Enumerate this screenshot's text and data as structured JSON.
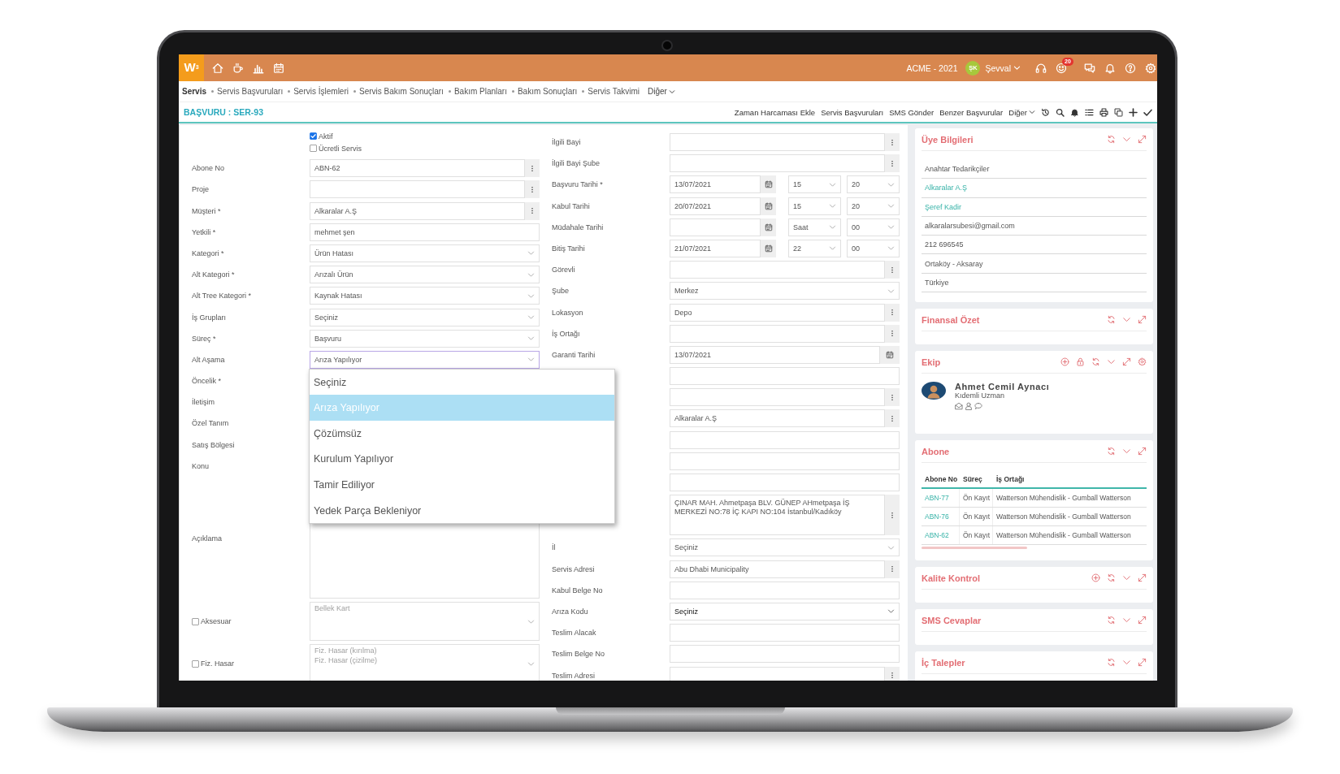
{
  "top_bar": {
    "logo": "W$^{3}$",
    "company": "ACME - 2021",
    "user": {
      "initials": "ŞK",
      "name": "Şevval"
    },
    "notification_count": "20"
  },
  "module_tabs": {
    "items": [
      {
        "label": "Servis",
        "selected": true
      },
      {
        "label": "Servis Başvuruları",
        "selected": false
      },
      {
        "label": "Servis İşlemleri",
        "selected": false
      },
      {
        "label": "Servis Bakım Sonuçları",
        "selected": false
      },
      {
        "label": "Bakım Planları",
        "selected": false
      },
      {
        "label": "Bakım Sonuçları",
        "selected": false
      },
      {
        "label": "Servis Takvimi",
        "selected": false
      }
    ],
    "more": "Diğer"
  },
  "page_header": {
    "title": "BAŞVURU : SER-93",
    "actions": [
      "Zaman Harcaması Ekle",
      "Servis Başvuruları",
      "SMS Gönder",
      "Benzer Başvurular"
    ],
    "more": "Diğer"
  },
  "form": {
    "checkboxes": [
      {
        "label": "Aktif",
        "checked": true
      },
      {
        "label": "Ücretli Servis",
        "checked": false
      }
    ],
    "left_rows": [
      {
        "label": "Abone No",
        "field": {
          "kind": "lookup",
          "value": "ABN-62"
        }
      },
      {
        "label": "Proje",
        "field": {
          "kind": "lookup"
        }
      },
      {
        "label": "Müşteri *",
        "field": {
          "kind": "lookup",
          "value": "Alkaralar A.Ş"
        }
      },
      {
        "label": "Yetkili *",
        "field": {
          "kind": "text",
          "value": "mehmet şen"
        }
      },
      {
        "label": "Kategori *",
        "field": {
          "kind": "select",
          "value": "Ürün Hatası"
        }
      },
      {
        "label": "Alt Kategori *",
        "field": {
          "kind": "select",
          "value": "Arızalı Ürün"
        }
      },
      {
        "label": "Alt Tree Kategori *",
        "field": {
          "kind": "select",
          "value": "Kaynak Hatası"
        }
      },
      {
        "label": "İş Grupları",
        "field": {
          "kind": "select",
          "value": "Seçiniz"
        }
      },
      {
        "label": "Süreç *",
        "field": {
          "kind": "select",
          "value": "Başvuru"
        }
      },
      {
        "label": "Alt Aşama",
        "field": {
          "kind": "select",
          "value": "Arıza Yapılıyor",
          "focused": true,
          "open": true,
          "options": [
            {
              "label": "Seçiniz",
              "selected": false
            },
            {
              "label": "Arıza Yapılıyor",
              "selected": true
            },
            {
              "label": "Çözümsüz",
              "selected": false
            },
            {
              "label": "Kurulum Yapılıyor",
              "selected": false
            },
            {
              "label": "Tamir Ediliyor",
              "selected": false
            },
            {
              "label": "Yedek Parça Bekleniyor",
              "selected": false
            }
          ]
        }
      },
      {
        "label": "Öncelik *"
      },
      {
        "label": "İletişim"
      },
      {
        "label": "Özel Tanım"
      },
      {
        "label": "Satış Bölgesi"
      },
      {
        "label": "Konu"
      },
      {
        "label": "Açıklama",
        "field": {
          "kind": "textarea"
        }
      },
      {
        "label": "Aksesuar",
        "checked": false,
        "field": {
          "kind": "listbox",
          "options": [
            "Bellek Kart"
          ]
        }
      },
      {
        "label": "Fiz. Hasar",
        "checked": false,
        "field": {
          "kind": "listbox",
          "options": [
            "Fiz. Hasar (kırılma)",
            "Fiz. Hasar (çizilme)"
          ]
        }
      }
    ],
    "right_rows": [
      {
        "label": "İlgili Bayi",
        "field": {
          "kind": "lookup"
        }
      },
      {
        "label": "İlgili Bayi Şube",
        "field": {
          "kind": "lookup"
        }
      },
      {
        "label": "Başvuru Tarihi *",
        "field": {
          "kind": "datetime",
          "date": "13/07/2021",
          "hour": "15",
          "minute": "20"
        }
      },
      {
        "label": "Kabul Tarihi",
        "field": {
          "kind": "datetime",
          "date": "20/07/2021",
          "hour": "15",
          "minute": "20"
        }
      },
      {
        "label": "Müdahale Tarihi",
        "field": {
          "kind": "datetime",
          "hour": "Saat",
          "minute": "00"
        }
      },
      {
        "label": "Bitiş Tarihi",
        "field": {
          "kind": "datetime",
          "date": "21/07/2021",
          "hour": "22",
          "minute": "00"
        }
      },
      {
        "label": "Görevli",
        "field": {
          "kind": "lookup"
        }
      },
      {
        "label": "Şube",
        "field": {
          "kind": "select",
          "value": "Merkez"
        }
      },
      {
        "label": "Lokasyon",
        "field": {
          "kind": "lookup",
          "value": "Depo"
        }
      },
      {
        "label": "İş Ortağı",
        "field": {
          "kind": "lookup"
        }
      },
      {
        "label": "Garanti Tarihi",
        "field": {
          "kind": "date",
          "value": "13/07/2021"
        }
      },
      {
        "field": {
          "kind": "text"
        }
      },
      {
        "field": {
          "kind": "lookup"
        }
      },
      {
        "field": {
          "kind": "lookup",
          "value": "Alkaralar A.Ş"
        }
      },
      {
        "field": {
          "kind": "text"
        }
      },
      {
        "field": {
          "kind": "text"
        }
      },
      {
        "field": {
          "kind": "text"
        }
      },
      {
        "field": {
          "kind": "address",
          "value": "ÇINAR MAH. Ahmetpaşa BLV. GÜNEP AHmetpaşa İŞ MERKEZİ NO:78 İÇ KAPI NO:104 İstanbul/Kadıköy"
        }
      },
      {
        "label": "İl",
        "field": {
          "kind": "select",
          "value": "Seçiniz"
        }
      },
      {
        "label": "Servis Adresi",
        "field": {
          "kind": "lookup",
          "value": "Abu Dhabi Municipality"
        }
      },
      {
        "label": "Kabul Belge No",
        "field": {
          "kind": "text"
        }
      },
      {
        "label": "Arıza Kodu",
        "field": {
          "kind": "native_select",
          "value": "Seçiniz"
        }
      },
      {
        "label": "Teslim Alacak",
        "field": {
          "kind": "text"
        }
      },
      {
        "label": "Teslim Belge No",
        "field": {
          "kind": "text"
        }
      },
      {
        "label": "Teslim Adresi",
        "field": {
          "kind": "lookup"
        }
      }
    ]
  },
  "side_panels": [
    {
      "title": "Üye Bilgileri",
      "kind": "list",
      "add_button": false,
      "lock_button": false,
      "settings_button": false,
      "items": [
        {
          "text": "Anahtar Tedarikçiler",
          "link": false
        },
        {
          "text": "Alkaralar A.Ş",
          "link": true
        },
        {
          "text": "Şeref Kadir",
          "link": true
        },
        {
          "text": "alkaralarsubesi@gmail.com",
          "link": false
        },
        {
          "text": "212 696545",
          "link": false
        },
        {
          "text": "Ortaköy - Aksaray",
          "link": false
        },
        {
          "text": "Türkiye",
          "link": false
        }
      ]
    },
    {
      "title": "Finansal Özet",
      "kind": "empty",
      "add_button": false,
      "lock_button": false,
      "settings_button": false
    },
    {
      "title": "Ekip",
      "kind": "team",
      "add_button": true,
      "lock_button": true,
      "settings_button": true,
      "members": [
        {
          "name": "Ahmet Cemil Aynacı",
          "role": "Kıdemli Uzman"
        }
      ]
    },
    {
      "title": "Abone",
      "kind": "table",
      "add_button": false,
      "lock_button": false,
      "settings_button": false,
      "columns": [
        "Abone No",
        "Süreç",
        "İş Ortağı"
      ],
      "rows": [
        [
          "ABN-77",
          "Ön Kayıt",
          "Watterson Mühendislik - Gumball Watterson"
        ],
        [
          "ABN-76",
          "Ön Kayıt",
          "Watterson Mühendislik - Gumball Watterson"
        ],
        [
          "ABN-62",
          "Ön Kayıt",
          "Watterson Mühendislik - Gumball Watterson"
        ]
      ]
    },
    {
      "title": "Kalite Kontrol",
      "kind": "empty",
      "add_button": true,
      "lock_button": false,
      "settings_button": false
    },
    {
      "title": "SMS Cevaplar",
      "kind": "empty",
      "add_button": false,
      "lock_button": false,
      "settings_button": false
    },
    {
      "title": "İç Talepler",
      "kind": "empty",
      "add_button": false,
      "lock_button": false,
      "settings_button": false
    }
  ]
}
